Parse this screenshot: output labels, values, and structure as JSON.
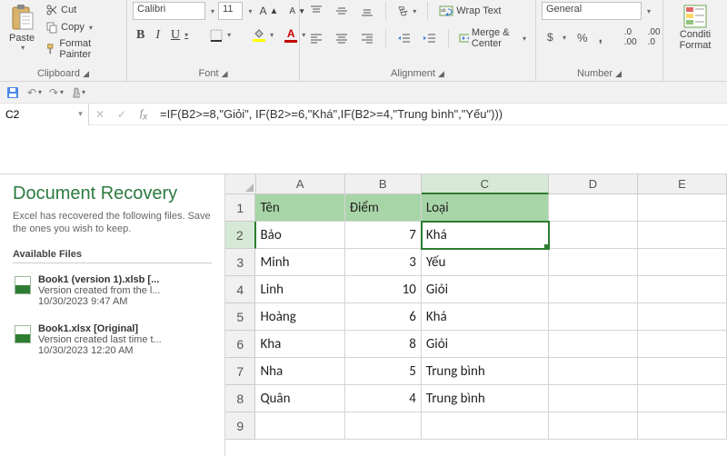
{
  "ribbon": {
    "clipboard": {
      "paste": "Paste",
      "cut": "Cut",
      "copy": "Copy",
      "format_painter": "Format Painter",
      "label": "Clipboard"
    },
    "font": {
      "name": "Calibri",
      "size": "11",
      "label": "Font"
    },
    "alignment": {
      "wrap": "Wrap Text",
      "merge": "Merge & Center",
      "label": "Alignment"
    },
    "number": {
      "format": "General",
      "label": "Number"
    },
    "styles": {
      "conditional": "Conditi",
      "conditional2": "Format"
    }
  },
  "namebox": "C2",
  "formula": "=IF(B2>=8,\"Giỏi\", IF(B2>=6,\"Khá\",IF(B2>=4,\"Trung bình\",\"Yếu\")))",
  "recovery": {
    "title": "Document Recovery",
    "subtitle": "Excel has recovered the following files. Save the ones you wish to keep.",
    "available": "Available Files",
    "files": [
      {
        "name": "Book1 (version 1).xlsb  [...",
        "desc": "Version created from the l...",
        "date": "10/30/2023 9:47 AM"
      },
      {
        "name": "Book1.xlsx  [Original]",
        "desc": "Version created last time t...",
        "date": "10/30/2023 12:20 AM"
      }
    ]
  },
  "columns": [
    "A",
    "B",
    "C",
    "D",
    "E"
  ],
  "headers": {
    "A": "Tên",
    "B": "Điểm",
    "C": "Loại"
  },
  "rows": [
    {
      "A": "Bảo",
      "B": "7",
      "C": "Khá"
    },
    {
      "A": "Minh",
      "B": "3",
      "C": "Yếu"
    },
    {
      "A": "Linh",
      "B": "10",
      "C": "Giỏi"
    },
    {
      "A": "Hoàng",
      "B": "6",
      "C": "Khá"
    },
    {
      "A": "Kha",
      "B": "8",
      "C": "Giỏi"
    },
    {
      "A": "Nha",
      "B": "5",
      "C": "Trung bình"
    },
    {
      "A": "Quân",
      "B": "4",
      "C": "Trung bình"
    }
  ],
  "active_cell": "C2"
}
